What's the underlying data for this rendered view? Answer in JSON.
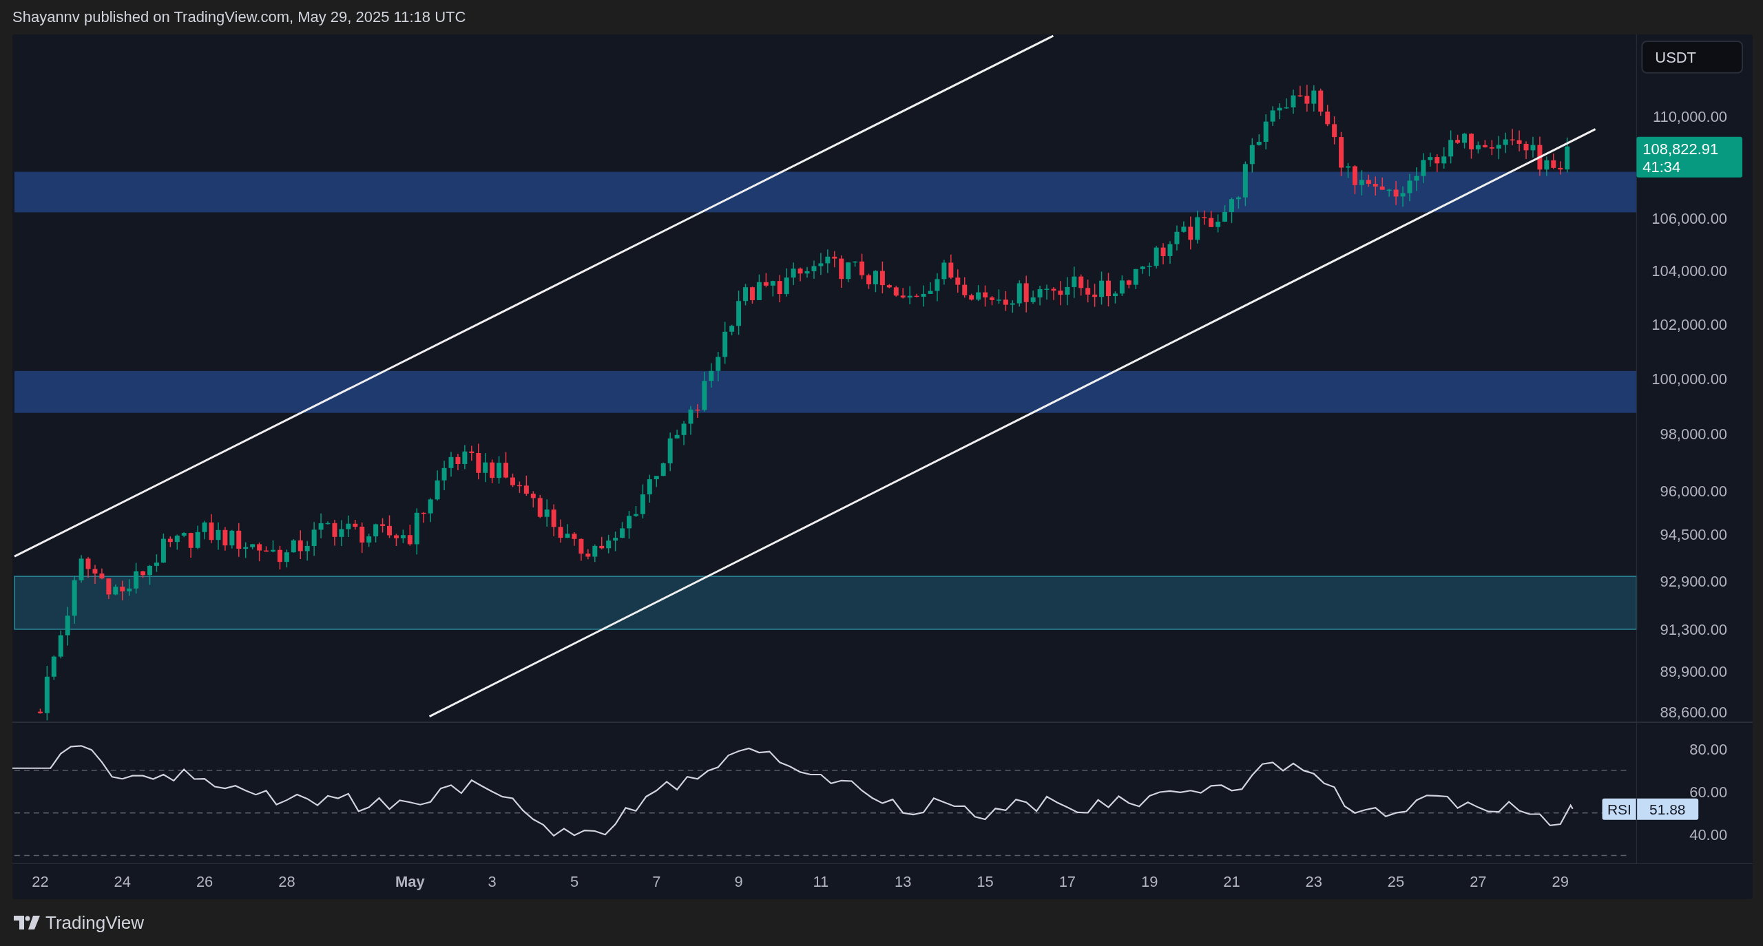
{
  "header": {
    "text": "Shayannv published on TradingView.com, May 29, 2025 11:18 UTC"
  },
  "price_chart": {
    "currency": "USDT",
    "last_price": "108,822.91",
    "countdown": "41:34",
    "price_axis": [
      "110,000.00",
      "106,000.00",
      "104,000.00",
      "102,000.00",
      "100,000.00",
      "98,000.00",
      "96,000.00",
      "94,500.00",
      "92,900.00",
      "91,300.00",
      "89,900.00",
      "88,600.00"
    ]
  },
  "rsi": {
    "label": "RSI",
    "value": "51.88",
    "axis": [
      "80.00",
      "60.00",
      "40.00"
    ]
  },
  "time_axis": [
    {
      "label": "22",
      "bold": false
    },
    {
      "label": "24",
      "bold": false
    },
    {
      "label": "26",
      "bold": false
    },
    {
      "label": "28",
      "bold": false
    },
    {
      "label": "May",
      "bold": true
    },
    {
      "label": "3",
      "bold": false
    },
    {
      "label": "5",
      "bold": false
    },
    {
      "label": "7",
      "bold": false
    },
    {
      "label": "9",
      "bold": false
    },
    {
      "label": "11",
      "bold": false
    },
    {
      "label": "13",
      "bold": false
    },
    {
      "label": "15",
      "bold": false
    },
    {
      "label": "17",
      "bold": false
    },
    {
      "label": "19",
      "bold": false
    },
    {
      "label": "21",
      "bold": false
    },
    {
      "label": "23",
      "bold": false
    },
    {
      "label": "25",
      "bold": false
    },
    {
      "label": "27",
      "bold": false
    },
    {
      "label": "29",
      "bold": false
    }
  ],
  "footer": {
    "brand": "TradingView"
  }
}
